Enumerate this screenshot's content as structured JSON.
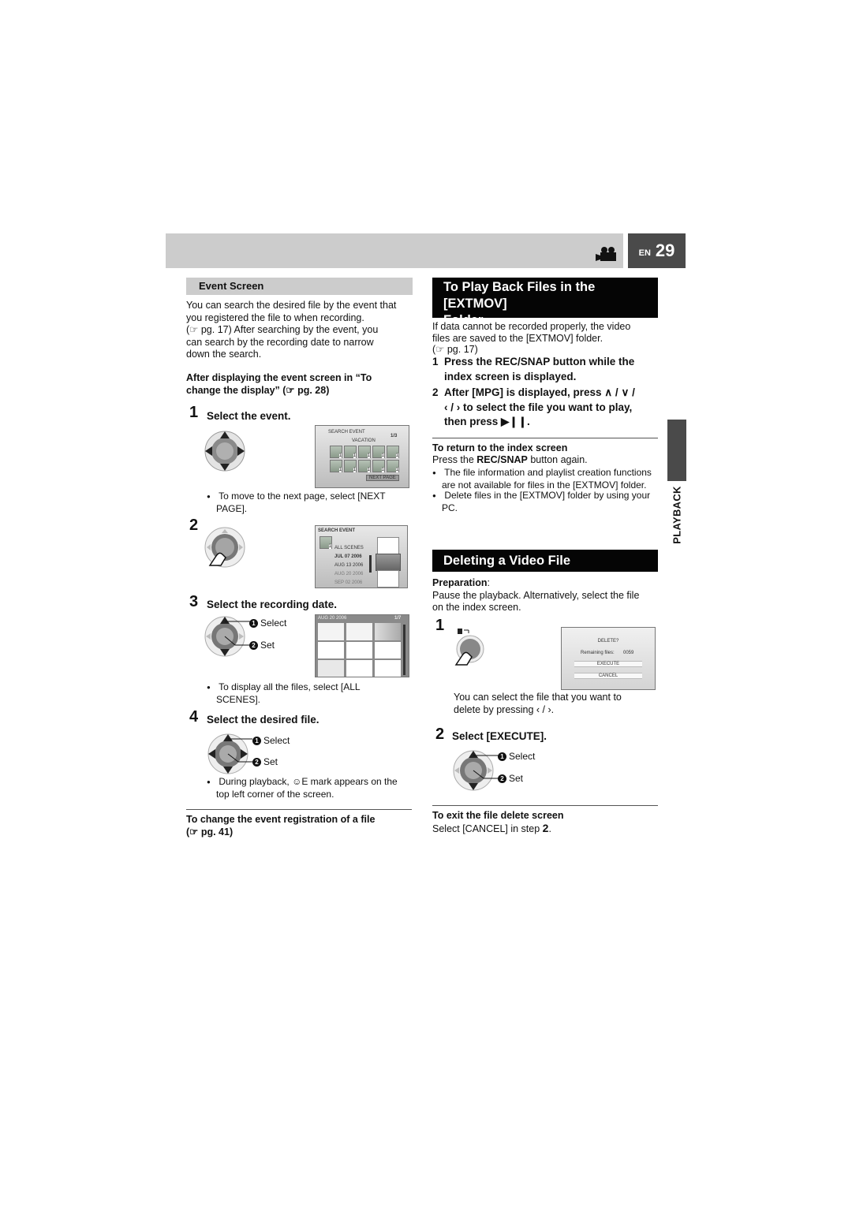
{
  "header": {
    "icon": "video-camera-icon",
    "lang": "EN",
    "page_number": "29"
  },
  "side_tab": {
    "label": "PLAYBACK"
  },
  "event_screen": {
    "section_title": "Event Screen",
    "intro_lines": [
      "You can search the desired file by the event that",
      "you registered the file to when recording.",
      "(☞ pg. 17) After searching by the event, you",
      "can search by the recording date to narrow",
      "down the search."
    ],
    "prereq_lines": [
      "After displaying the event screen in “To",
      "change the display” (☞ pg. 28)"
    ],
    "steps": [
      {
        "num": "1",
        "title": "Select the event.",
        "screen": {
          "title": "SEARCH EVENT",
          "page": "1/3",
          "category": "VACATION",
          "thumb_count": "1",
          "button": "NEXT PAGE"
        },
        "note": [
          "To move to the next page, select [NEXT",
          "PAGE]."
        ]
      },
      {
        "num": "2",
        "screen": {
          "title": "SEARCH EVENT",
          "thumb_count": "1",
          "list": [
            "ALL SCENES",
            "JUL  07  2006",
            "AUG  13  2006",
            "AUG  20  2006",
            "SEP  02  2006"
          ]
        }
      },
      {
        "num": "3",
        "title": "Select the recording date.",
        "callouts": [
          {
            "n": "1",
            "label": "Select"
          },
          {
            "n": "2",
            "label": "Set"
          }
        ],
        "screen": {
          "date": "AUG 20 2006",
          "page": "1/7"
        },
        "note": [
          "To display all the files, select [ALL",
          "SCENES]."
        ]
      },
      {
        "num": "4",
        "title": "Select the desired file.",
        "callouts": [
          {
            "n": "1",
            "label": "Select"
          },
          {
            "n": "2",
            "label": "Set"
          }
        ],
        "note_pre": "During playback, ",
        "note_mark": "☺E",
        "note_post": " mark appears on the",
        "note_line2": "top left corner of the screen."
      }
    ],
    "footer_lines": [
      "To change the event registration of a file",
      "(☞ pg. 41)"
    ]
  },
  "extmov": {
    "title_lines": [
      "To Play Back Files in the [EXTMOV]",
      "Folder"
    ],
    "intro_lines": [
      "If data cannot be recorded properly, the video",
      "files are saved to the [EXTMOV] folder.",
      "(☞ pg. 17)"
    ],
    "steps": [
      {
        "num": "1",
        "lines": [
          "Press the REC/SNAP button while the",
          "index screen is displayed."
        ]
      },
      {
        "num": "2",
        "lines": [
          "After [MPG] is displayed, press ∧ / ∨ /",
          "‹ / › to select the file you want to play,",
          "then press ▶❙❙."
        ]
      }
    ],
    "return_title": "To return to the index screen",
    "return_pre": "Press the ",
    "return_bold": "REC/SNAP",
    "return_post": " button again.",
    "notes": [
      [
        "The file information and playlist creation functions",
        "are not available for files in the [EXTMOV] folder."
      ],
      [
        "Delete files in the [EXTMOV] folder by using your",
        "PC."
      ]
    ]
  },
  "delete": {
    "title": "Deleting a Video File",
    "prep_label": "Preparation",
    "prep_colon": ":",
    "prep_lines": [
      "Pause the playback. Alternatively, select the file",
      "on the index screen."
    ],
    "step1": {
      "num": "1",
      "screen": {
        "question": "DELETE?",
        "remaining_label": "Remaining files:",
        "remaining_value": "0059",
        "execute": "EXECUTE",
        "cancel": "CANCEL"
      },
      "note_lines": [
        "You can select the file that you want to",
        "delete by pressing ‹ / ›."
      ]
    },
    "step2": {
      "num": "2",
      "title": "Select [EXECUTE].",
      "callouts": [
        {
          "n": "1",
          "label": "Select"
        },
        {
          "n": "2",
          "label": "Set"
        }
      ]
    },
    "exit_title": "To exit the file delete screen",
    "exit_pre": "Select [CANCEL] in step ",
    "exit_step": "2",
    "exit_post": "."
  }
}
